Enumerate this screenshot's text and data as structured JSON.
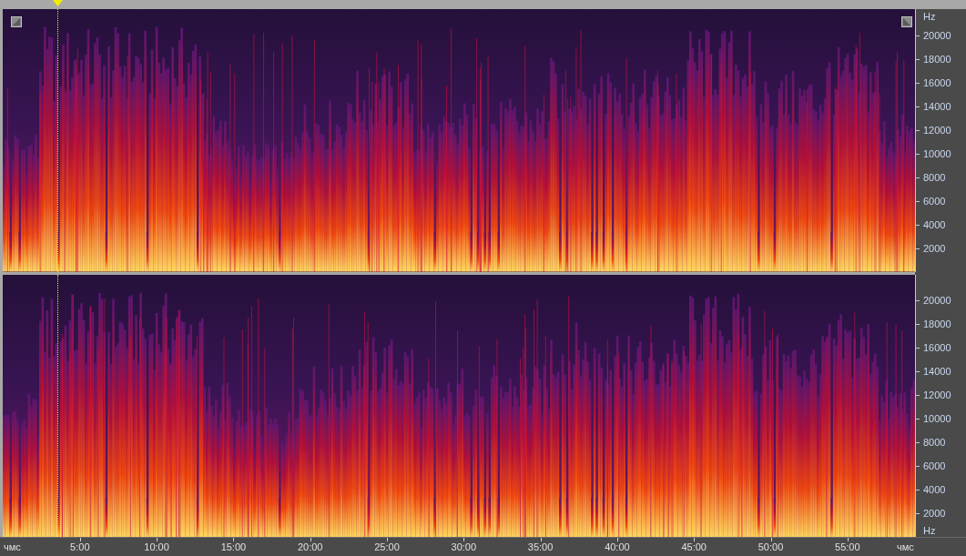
{
  "channels": [
    {
      "unit_label_top": "Hz",
      "frequency_ticks": [
        "20000",
        "18000",
        "16000",
        "14000",
        "12000",
        "10000",
        "8000",
        "6000",
        "4000",
        "2000"
      ]
    },
    {
      "frequency_ticks": [
        "20000",
        "18000",
        "16000",
        "14000",
        "12000",
        "10000",
        "8000",
        "6000",
        "4000",
        "2000"
      ],
      "unit_label_bottom": "Hz"
    }
  ],
  "time_axis": {
    "unit_label_left": "чмс",
    "unit_label_right": "чмс",
    "ticks": [
      "5:00",
      "10:00",
      "15:00",
      "20:00",
      "25:00",
      "30:00",
      "35:00",
      "40:00",
      "45:00",
      "50:00",
      "55:00"
    ]
  }
}
